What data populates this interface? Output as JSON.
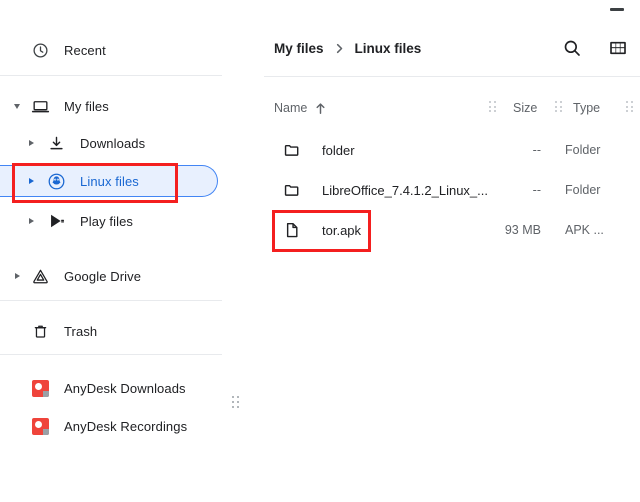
{
  "window": {
    "minimize_label": "minimize"
  },
  "sidebar": {
    "items": [
      {
        "label": "Recent",
        "icon": "clock-icon",
        "indent": 0,
        "twisty": "none",
        "selected": false
      },
      {
        "label": "My files",
        "icon": "laptop-icon",
        "indent": 0,
        "twisty": "down",
        "selected": false
      },
      {
        "label": "Downloads",
        "icon": "download-icon",
        "indent": 1,
        "twisty": "right",
        "selected": false
      },
      {
        "label": "Linux files",
        "icon": "linux-penguin-icon",
        "indent": 1,
        "twisty": "right",
        "selected": true
      },
      {
        "label": "Play files",
        "icon": "play-store-icon",
        "indent": 1,
        "twisty": "right",
        "selected": false
      },
      {
        "label": "Google Drive",
        "icon": "google-drive-icon",
        "indent": 0,
        "twisty": "right",
        "selected": false
      },
      {
        "label": "Trash",
        "icon": "trash-icon",
        "indent": 0,
        "twisty": "none",
        "selected": false
      },
      {
        "label": "AnyDesk Downloads",
        "icon": "anydesk-icon",
        "indent": 0,
        "twisty": "none",
        "selected": false
      },
      {
        "label": "AnyDesk Recordings",
        "icon": "anydesk-icon",
        "indent": 0,
        "twisty": "none",
        "selected": false
      }
    ],
    "resize_handle": "drag-handle-icon"
  },
  "breadcrumb": {
    "parent": "My files",
    "separator": "›",
    "current": "Linux files"
  },
  "header_actions": {
    "search": "search-icon",
    "view_toggle": "grid-view-icon"
  },
  "columns": {
    "name": "Name",
    "sort_indicator": "↑",
    "size": "Size",
    "type": "Type"
  },
  "files": [
    {
      "name": "folder",
      "size": "--",
      "type": "Folder",
      "icon": "folder-icon",
      "highlighted": false
    },
    {
      "name": "LibreOffice_7.4.1.2_Linux_...",
      "size": "--",
      "type": "Folder",
      "icon": "folder-icon",
      "highlighted": false
    },
    {
      "name": "tor.apk",
      "size": "93 MB",
      "type": "APK ...",
      "icon": "file-icon",
      "highlighted": true
    }
  ],
  "annotations": {
    "accent_red": "#f41f1f",
    "selection_blue": "#4285f4",
    "selection_fill": "#e8f0fe"
  }
}
